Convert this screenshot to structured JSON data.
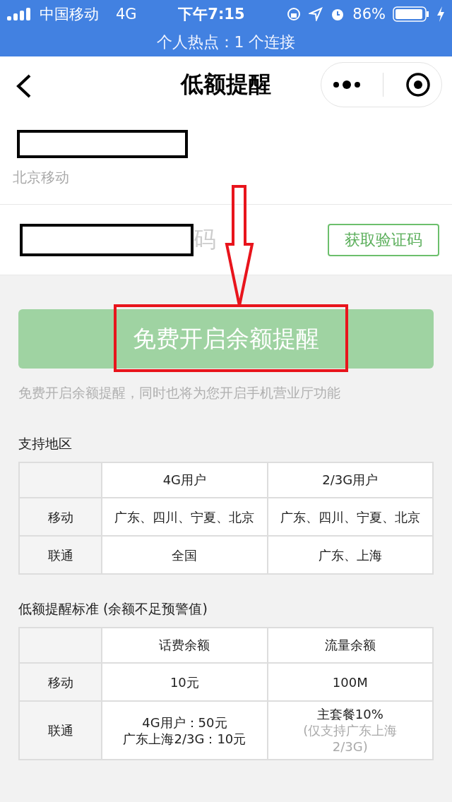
{
  "status_bar": {
    "carrier": "中国移动",
    "network": "4G",
    "time": "下午7:15",
    "battery": "86%"
  },
  "hotspot_banner": "个人热点：1 个连接",
  "nav": {
    "title": "低额提醒"
  },
  "phone_row": {
    "operator": "北京移动"
  },
  "code_row": {
    "placeholder_tail": "码",
    "button": "获取验证码"
  },
  "submit": {
    "label": "免费开启余额提醒",
    "disabled": true
  },
  "note": "免费开启余额提醒，同时也将为您开启手机营业厅功能",
  "sections": [
    {
      "title": "支持地区",
      "table": {
        "columns": [
          "",
          "4G用户",
          "2/3G用户"
        ],
        "rows": [
          {
            "cells": [
              [
                "移动"
              ],
              [
                "广东、四川、宁夏、北京"
              ],
              [
                "广东、四川、宁夏、北京"
              ]
            ]
          },
          {
            "cells": [
              [
                "联通"
              ],
              [
                "全国"
              ],
              [
                "广东、上海"
              ]
            ]
          }
        ]
      }
    },
    {
      "title": "低额提醒标准 (余额不足预警值)",
      "table": {
        "columns": [
          "",
          "话费余额",
          "流量余额"
        ],
        "rows": [
          {
            "cells": [
              [
                "移动"
              ],
              [
                "10元"
              ],
              [
                "100M"
              ]
            ]
          },
          {
            "cells": [
              [
                "联通"
              ],
              [
                "4G用户：50元",
                "广东上海2/3G：10元"
              ],
              [
                "主套餐10%",
                "(仅支持广东上海",
                "2/3G)"
              ]
            ]
          }
        ]
      }
    }
  ]
}
